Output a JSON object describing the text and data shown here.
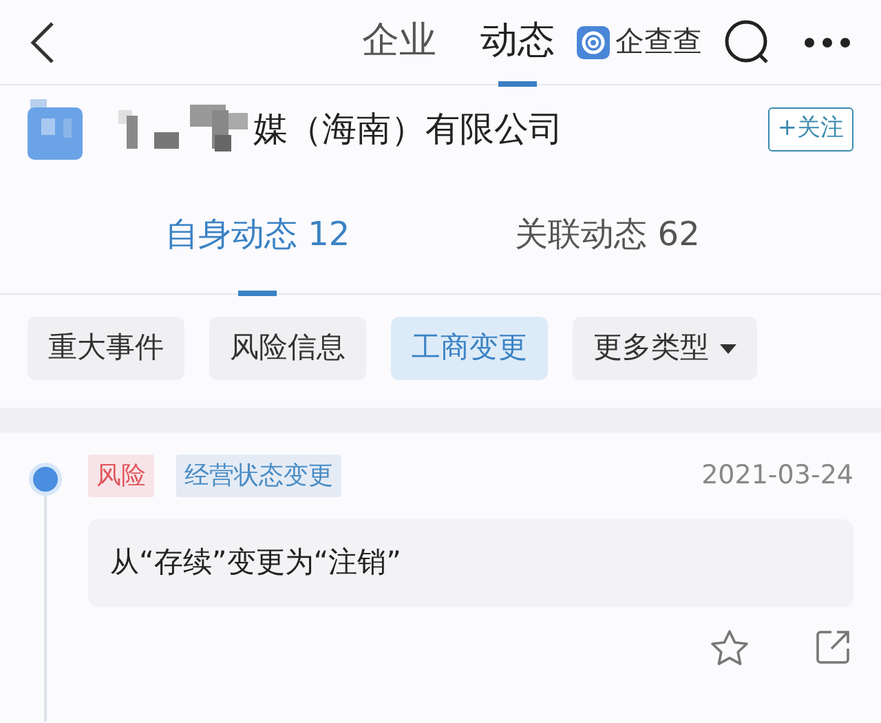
{
  "nav_tabs": [
    {
      "label": "企业",
      "selected": false
    },
    {
      "label": "动态",
      "selected": true
    }
  ],
  "brand": {
    "label": "企查查"
  },
  "company": {
    "name": "媒（海南）有限公司",
    "follow_button": "+关注"
  },
  "sub_tabs": [
    {
      "label": "自身动态 12",
      "selected": true
    },
    {
      "label": "关联动态 62",
      "selected": false
    }
  ],
  "filters": [
    {
      "label": "重大事件",
      "selected": false,
      "kind": "chip"
    },
    {
      "label": "风险信息",
      "selected": false,
      "kind": "chip"
    },
    {
      "label": "工商变更",
      "selected": true,
      "kind": "chip"
    },
    {
      "label": "更多类型",
      "selected": false,
      "kind": "dropdown"
    }
  ],
  "events": [
    {
      "tags": [
        {
          "label": "风险",
          "color": "#e0555a"
        },
        {
          "label": "经营状态变更",
          "color": "#4a8cc4"
        }
      ],
      "date": "2021-03-24",
      "content": "从“存续”变更为“注销”"
    }
  ]
}
